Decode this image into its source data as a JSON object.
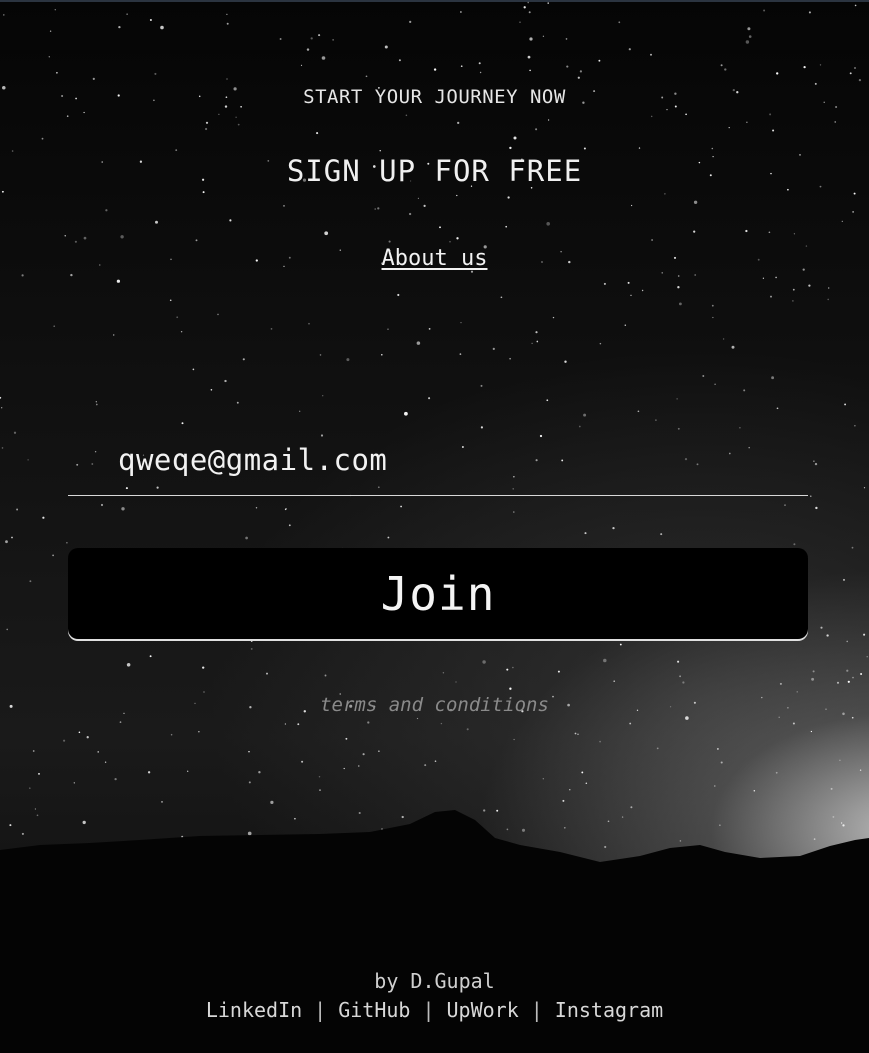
{
  "header": {
    "subtitle": "START YOUR JOURNEY NOW",
    "title": "SIGN UP FOR FREE",
    "about_link": "About us"
  },
  "form": {
    "email_value": "qweqe@gmail.com",
    "join_label": "Join",
    "terms_link": "terms and conditions"
  },
  "footer": {
    "author": "by D.Gupal",
    "links": [
      "LinkedIn",
      "GitHub",
      "UpWork",
      "Instagram"
    ],
    "separator": "|"
  },
  "colors": {
    "background": "#0a0a0a",
    "text": "#e8e8e8",
    "button_bg": "#000000",
    "muted_text": "#8a8a8a"
  }
}
